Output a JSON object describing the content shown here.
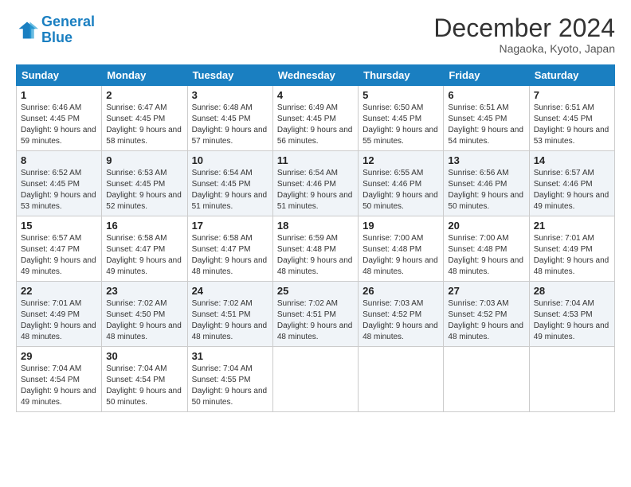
{
  "header": {
    "logo_line1": "General",
    "logo_line2": "Blue",
    "month_title": "December 2024",
    "location": "Nagaoka, Kyoto, Japan"
  },
  "weekdays": [
    "Sunday",
    "Monday",
    "Tuesday",
    "Wednesday",
    "Thursday",
    "Friday",
    "Saturday"
  ],
  "weeks": [
    [
      {
        "day": "1",
        "sunrise": "6:46 AM",
        "sunset": "4:45 PM",
        "daylight": "9 hours and 59 minutes."
      },
      {
        "day": "2",
        "sunrise": "6:47 AM",
        "sunset": "4:45 PM",
        "daylight": "9 hours and 58 minutes."
      },
      {
        "day": "3",
        "sunrise": "6:48 AM",
        "sunset": "4:45 PM",
        "daylight": "9 hours and 57 minutes."
      },
      {
        "day": "4",
        "sunrise": "6:49 AM",
        "sunset": "4:45 PM",
        "daylight": "9 hours and 56 minutes."
      },
      {
        "day": "5",
        "sunrise": "6:50 AM",
        "sunset": "4:45 PM",
        "daylight": "9 hours and 55 minutes."
      },
      {
        "day": "6",
        "sunrise": "6:51 AM",
        "sunset": "4:45 PM",
        "daylight": "9 hours and 54 minutes."
      },
      {
        "day": "7",
        "sunrise": "6:51 AM",
        "sunset": "4:45 PM",
        "daylight": "9 hours and 53 minutes."
      }
    ],
    [
      {
        "day": "8",
        "sunrise": "6:52 AM",
        "sunset": "4:45 PM",
        "daylight": "9 hours and 53 minutes."
      },
      {
        "day": "9",
        "sunrise": "6:53 AM",
        "sunset": "4:45 PM",
        "daylight": "9 hours and 52 minutes."
      },
      {
        "day": "10",
        "sunrise": "6:54 AM",
        "sunset": "4:45 PM",
        "daylight": "9 hours and 51 minutes."
      },
      {
        "day": "11",
        "sunrise": "6:54 AM",
        "sunset": "4:46 PM",
        "daylight": "9 hours and 51 minutes."
      },
      {
        "day": "12",
        "sunrise": "6:55 AM",
        "sunset": "4:46 PM",
        "daylight": "9 hours and 50 minutes."
      },
      {
        "day": "13",
        "sunrise": "6:56 AM",
        "sunset": "4:46 PM",
        "daylight": "9 hours and 50 minutes."
      },
      {
        "day": "14",
        "sunrise": "6:57 AM",
        "sunset": "4:46 PM",
        "daylight": "9 hours and 49 minutes."
      }
    ],
    [
      {
        "day": "15",
        "sunrise": "6:57 AM",
        "sunset": "4:47 PM",
        "daylight": "9 hours and 49 minutes."
      },
      {
        "day": "16",
        "sunrise": "6:58 AM",
        "sunset": "4:47 PM",
        "daylight": "9 hours and 49 minutes."
      },
      {
        "day": "17",
        "sunrise": "6:58 AM",
        "sunset": "4:47 PM",
        "daylight": "9 hours and 48 minutes."
      },
      {
        "day": "18",
        "sunrise": "6:59 AM",
        "sunset": "4:48 PM",
        "daylight": "9 hours and 48 minutes."
      },
      {
        "day": "19",
        "sunrise": "7:00 AM",
        "sunset": "4:48 PM",
        "daylight": "9 hours and 48 minutes."
      },
      {
        "day": "20",
        "sunrise": "7:00 AM",
        "sunset": "4:48 PM",
        "daylight": "9 hours and 48 minutes."
      },
      {
        "day": "21",
        "sunrise": "7:01 AM",
        "sunset": "4:49 PM",
        "daylight": "9 hours and 48 minutes."
      }
    ],
    [
      {
        "day": "22",
        "sunrise": "7:01 AM",
        "sunset": "4:49 PM",
        "daylight": "9 hours and 48 minutes."
      },
      {
        "day": "23",
        "sunrise": "7:02 AM",
        "sunset": "4:50 PM",
        "daylight": "9 hours and 48 minutes."
      },
      {
        "day": "24",
        "sunrise": "7:02 AM",
        "sunset": "4:51 PM",
        "daylight": "9 hours and 48 minutes."
      },
      {
        "day": "25",
        "sunrise": "7:02 AM",
        "sunset": "4:51 PM",
        "daylight": "9 hours and 48 minutes."
      },
      {
        "day": "26",
        "sunrise": "7:03 AM",
        "sunset": "4:52 PM",
        "daylight": "9 hours and 48 minutes."
      },
      {
        "day": "27",
        "sunrise": "7:03 AM",
        "sunset": "4:52 PM",
        "daylight": "9 hours and 48 minutes."
      },
      {
        "day": "28",
        "sunrise": "7:04 AM",
        "sunset": "4:53 PM",
        "daylight": "9 hours and 49 minutes."
      }
    ],
    [
      {
        "day": "29",
        "sunrise": "7:04 AM",
        "sunset": "4:54 PM",
        "daylight": "9 hours and 49 minutes."
      },
      {
        "day": "30",
        "sunrise": "7:04 AM",
        "sunset": "4:54 PM",
        "daylight": "9 hours and 50 minutes."
      },
      {
        "day": "31",
        "sunrise": "7:04 AM",
        "sunset": "4:55 PM",
        "daylight": "9 hours and 50 minutes."
      },
      null,
      null,
      null,
      null
    ]
  ]
}
